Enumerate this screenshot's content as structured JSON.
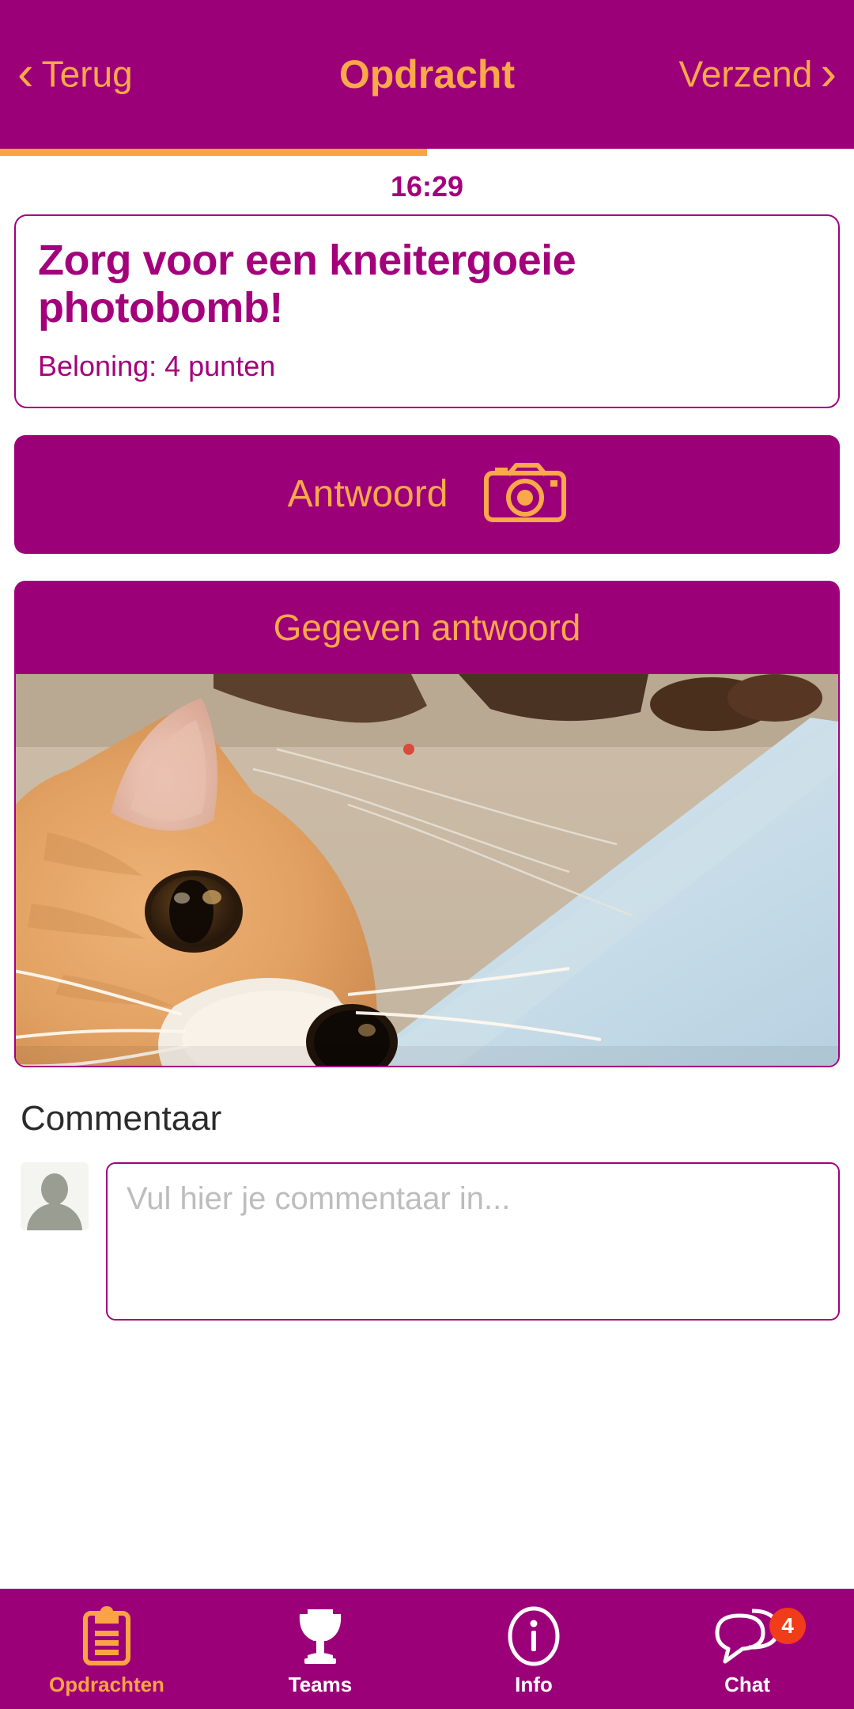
{
  "header": {
    "back_label": "Terug",
    "title": "Opdracht",
    "send_label": "Verzend",
    "back_chevron": "‹",
    "send_chevron": "›",
    "bg_color": "#9c0079",
    "accent_color": "#f9a84a"
  },
  "progress": {
    "percent": 50,
    "fill_color": "#f9a343"
  },
  "task": {
    "timestamp": "16:29",
    "title": "Zorg voor een kneitergoeie photobomb!",
    "reward": "Beloning: 4 punten",
    "points": 4
  },
  "answer_button": {
    "label": "Antwoord",
    "icon": "camera-icon"
  },
  "given_answer": {
    "header": "Gegeven antwoord",
    "photo_description": "Close-up photobomb van een oranje-witte kat voor een lichtblauwe achtergrond"
  },
  "comments": {
    "title": "Commentaar",
    "avatar": "default-avatar",
    "placeholder": "Vul hier je commentaar in..."
  },
  "tabbar": {
    "items": [
      {
        "label": "Opdrachten",
        "icon": "clipboard-icon",
        "active": true,
        "badge": null
      },
      {
        "label": "Teams",
        "icon": "trophy-icon",
        "active": false,
        "badge": null
      },
      {
        "label": "Info",
        "icon": "info-circle-icon",
        "active": false,
        "badge": null
      },
      {
        "label": "Chat",
        "icon": "chat-bubbles-icon",
        "active": false,
        "badge": "4"
      }
    ],
    "badge_color": "#f03c18",
    "active_color": "#f9a343",
    "inactive_color": "#ffffff"
  }
}
